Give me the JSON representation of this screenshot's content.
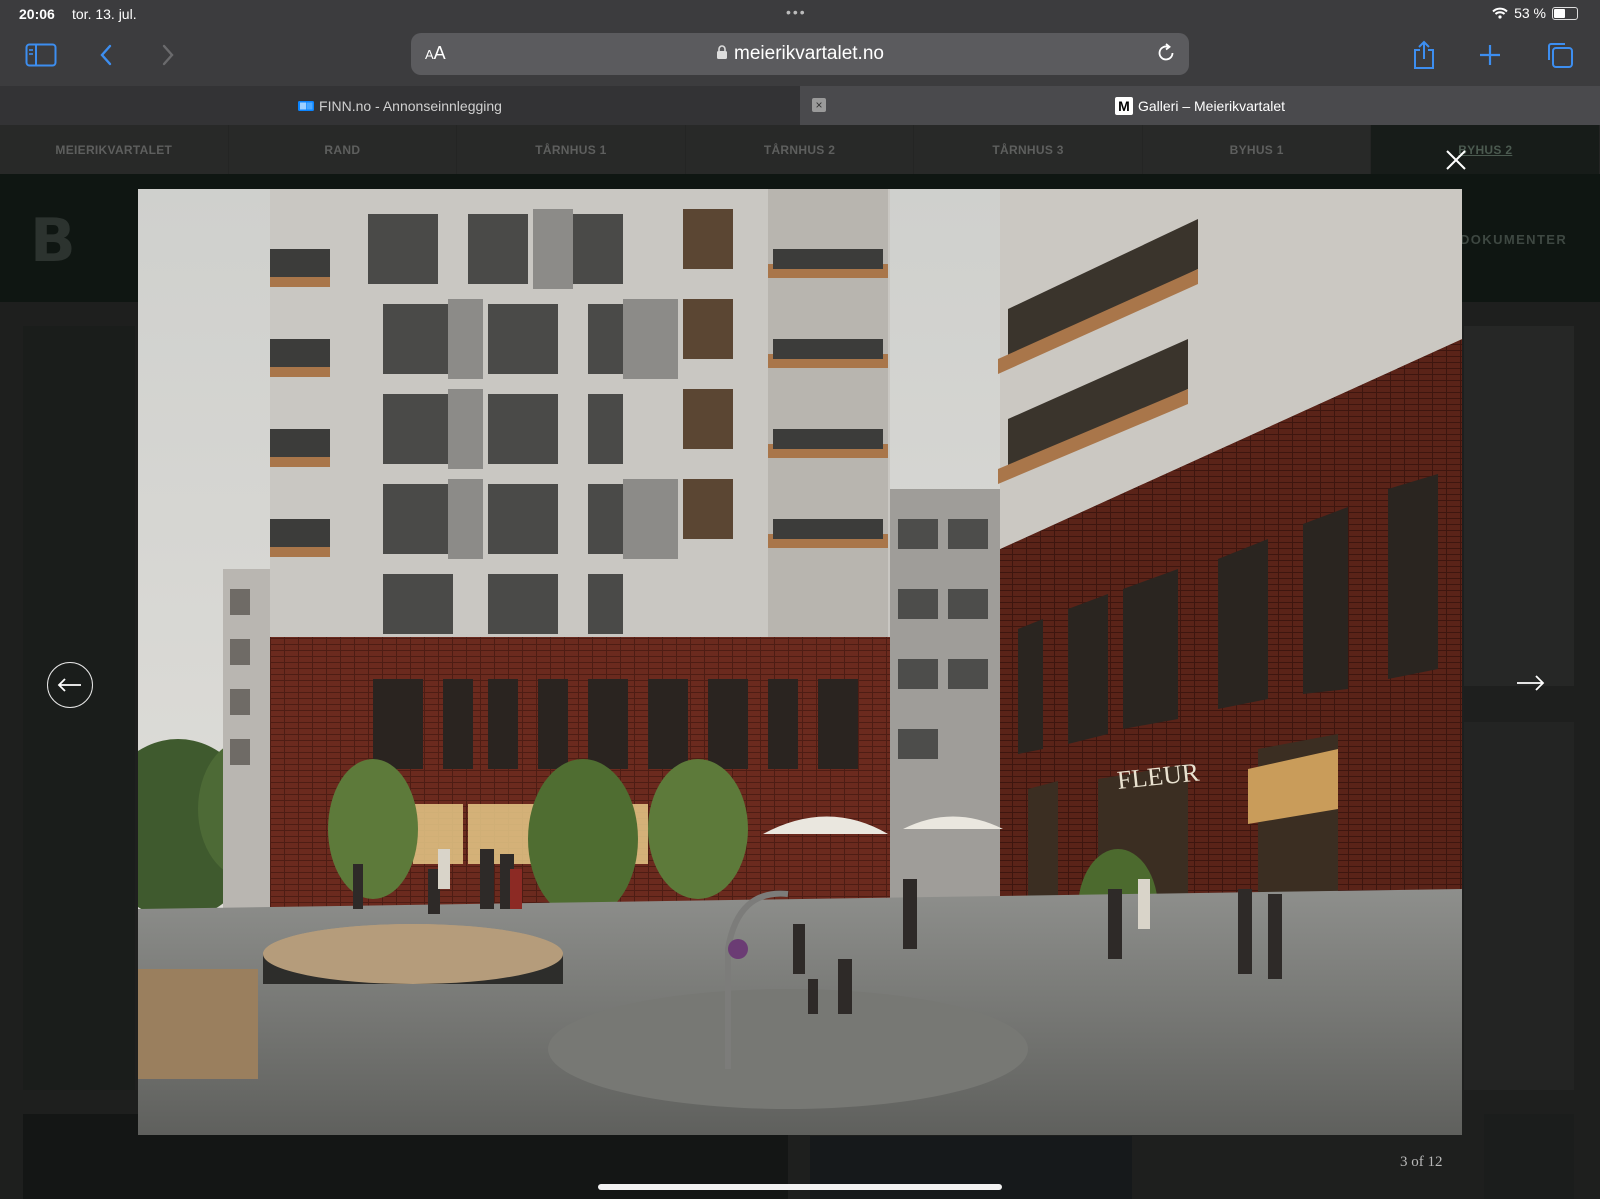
{
  "status_bar": {
    "time": "20:06",
    "date": "tor. 13. jul.",
    "battery_text": "53 %",
    "battery_level": 0.53
  },
  "toolbar": {
    "text_size_label_small": "A",
    "text_size_label_large": "A",
    "url": "meierikvartalet.no"
  },
  "tabs": [
    {
      "title": "FINN.no - Annonseinnlegging",
      "favicon": "finn-icon"
    },
    {
      "title": "Galleri – Meierikvartalet",
      "favicon": "meierikvartalet-m-icon",
      "favicon_letter": "M"
    }
  ],
  "site_nav": {
    "items": [
      "MEIERIKVARTALET",
      "RAND",
      "TÅRNHUS 1",
      "TÅRNHUS 2",
      "TÅRNHUS 3",
      "BYHUS 1",
      "BYHUS 2"
    ]
  },
  "site_header": {
    "logo_letter": "B",
    "menu_right": "DOKUMENTER"
  },
  "lightbox": {
    "counter": "3 of 12",
    "sign_text": "FLEUR",
    "colors": {
      "brick": "#6b2a1e",
      "facade": "#c9c7c2",
      "sky": "#d9d9d6",
      "pavement": "#9a9a98"
    }
  }
}
